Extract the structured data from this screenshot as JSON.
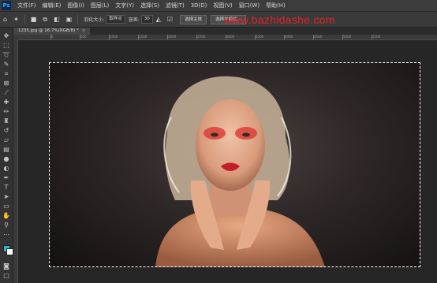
{
  "app": {
    "logo": "Ps"
  },
  "menu": [
    "文件(F)",
    "编辑(E)",
    "图像(I)",
    "图层(L)",
    "文字(Y)",
    "选择(S)",
    "滤镜(T)",
    "3D(D)",
    "视图(V)",
    "窗口(W)",
    "帮助(H)"
  ],
  "options": {
    "feather_label": "羽化大小:",
    "feather_value": "取样点",
    "tolerance_label": "容差:",
    "tolerance_value": "30",
    "select_subject_button": "选择主体",
    "select_and_mask_button": "选择并遮住..."
  },
  "watermark": "www.bazhidashe.com",
  "document_tab": {
    "title": "1235.jpg @ 16.7%(RGB/8) *"
  },
  "ruler": {
    "ticks": [
      "0",
      "500",
      "1000",
      "1500",
      "2000",
      "2500",
      "3000",
      "3500",
      "4000",
      "4500",
      "5000",
      "5500"
    ]
  },
  "colors": {
    "accent": "#31a8ff",
    "watermark": "#e0232a",
    "background": "#282828"
  },
  "toolbar_icons": [
    "move-icon",
    "marquee-icon",
    "lasso-icon",
    "quick-select-icon",
    "crop-icon",
    "frame-icon",
    "eyedropper-icon",
    "healing-icon",
    "brush-icon",
    "stamp-icon",
    "history-brush-icon",
    "eraser-icon",
    "gradient-icon",
    "blur-icon",
    "dodge-icon",
    "pen-icon",
    "type-icon",
    "path-select-icon",
    "rectangle-icon",
    "hand-icon",
    "zoom-icon",
    "more-icon"
  ]
}
